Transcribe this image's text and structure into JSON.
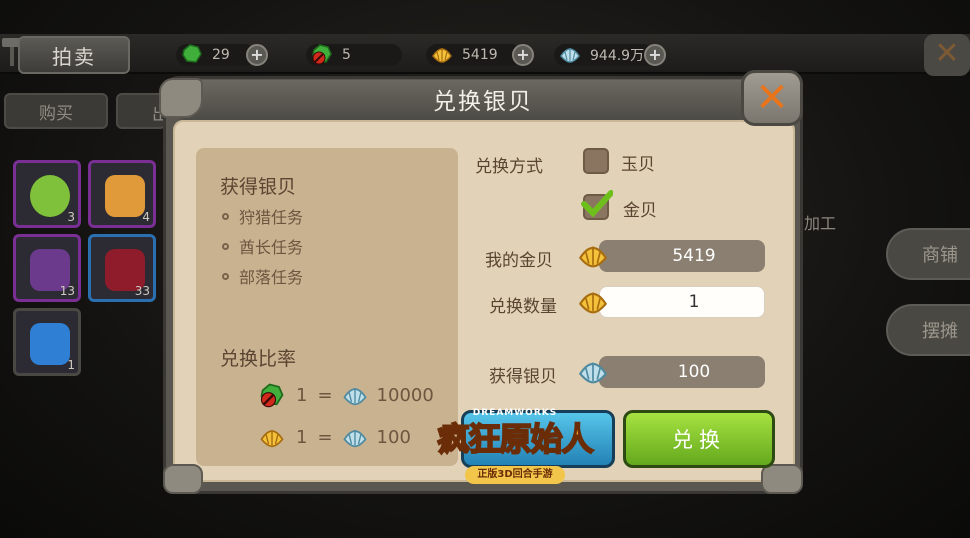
{
  "topbar": {
    "auction_label": "拍卖",
    "resources": [
      {
        "icon": "green-jade-icon",
        "value": "29"
      },
      {
        "icon": "green-jade-bound-icon",
        "value": "5"
      },
      {
        "icon": "gold-shell-icon",
        "value": "5419"
      },
      {
        "icon": "silver-shell-icon",
        "value": "944.9万"
      }
    ]
  },
  "background": {
    "buy_tab": "购买",
    "sell_tab": "出",
    "slots": [
      {
        "count": "3",
        "color": "#7fc13a"
      },
      {
        "count": "4",
        "color": "#e19a3a"
      },
      {
        "count": "13",
        "color": "#6b3a8c"
      },
      {
        "count": "33",
        "color": "#8e1c2a"
      },
      {
        "count": "1",
        "color": "#2f7fd4"
      }
    ],
    "right_buttons": [
      "商铺",
      "摆摊"
    ],
    "side_text": "加工"
  },
  "dialog": {
    "title": "兑换银贝",
    "info": {
      "obtain_heading": "获得银贝",
      "obtain_items": [
        "狩猎任务",
        "酋长任务",
        "部落任务"
      ],
      "rate_heading": "兑换比率",
      "rates": [
        {
          "from": "1",
          "equals": "=",
          "to": "10000"
        },
        {
          "from": "1",
          "equals": "=",
          "to": "100"
        }
      ]
    },
    "method_label": "兑换方式",
    "options": [
      {
        "label": "玉贝",
        "checked": false
      },
      {
        "label": "金贝",
        "checked": true
      }
    ],
    "my_gold_label": "我的金贝",
    "my_gold_value": "5419",
    "quantity_label": "兑换数量",
    "quantity_value": "1",
    "obtain_label": "获得银贝",
    "obtain_value": "100",
    "confirm_label": "兑换"
  },
  "logo": {
    "small": "DREAMWORKS",
    "main": "疯狂原始人",
    "sub": "正版3D回合手游"
  },
  "colors": {
    "accent_green": "#7cc22a",
    "close_orange": "#e8751b",
    "parchment": "#e2d2b7"
  }
}
